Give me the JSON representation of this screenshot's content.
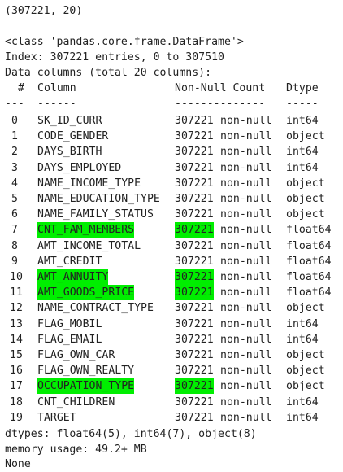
{
  "shape_output": "(307221, 20)",
  "class_line": "<class 'pandas.core.frame.DataFrame'>",
  "index_line": "Index: 307221 entries, 0 to 307510",
  "data_columns_line": "Data columns (total 20 columns):",
  "header": {
    "num": " #",
    "column": "Column",
    "count": "Non-Null Count",
    "dtype": "Dtype"
  },
  "separator": {
    "num": "---",
    "column": "------",
    "count": "--------------",
    "dtype": "-----"
  },
  "highlight_color": "#00ee00",
  "rows": [
    {
      "num": "0",
      "name": "SK_ID_CURR",
      "count": "307221",
      "nonnull": "non-null",
      "dtype": "int64",
      "highlight": false
    },
    {
      "num": "1",
      "name": "CODE_GENDER",
      "count": "307221",
      "nonnull": "non-null",
      "dtype": "object",
      "highlight": false
    },
    {
      "num": "2",
      "name": "DAYS_BIRTH",
      "count": "307221",
      "nonnull": "non-null",
      "dtype": "int64",
      "highlight": false
    },
    {
      "num": "3",
      "name": "DAYS_EMPLOYED",
      "count": "307221",
      "nonnull": "non-null",
      "dtype": "int64",
      "highlight": false
    },
    {
      "num": "4",
      "name": "NAME_INCOME_TYPE",
      "count": "307221",
      "nonnull": "non-null",
      "dtype": "object",
      "highlight": false
    },
    {
      "num": "5",
      "name": "NAME_EDUCATION_TYPE",
      "count": "307221",
      "nonnull": "non-null",
      "dtype": "object",
      "highlight": false
    },
    {
      "num": "6",
      "name": "NAME_FAMILY_STATUS",
      "count": "307221",
      "nonnull": "non-null",
      "dtype": "object",
      "highlight": false
    },
    {
      "num": "7",
      "name": "CNT_FAM_MEMBERS",
      "count": "307221",
      "nonnull": "non-null",
      "dtype": "float64",
      "highlight": true
    },
    {
      "num": "8",
      "name": "AMT_INCOME_TOTAL",
      "count": "307221",
      "nonnull": "non-null",
      "dtype": "float64",
      "highlight": false
    },
    {
      "num": "9",
      "name": "AMT_CREDIT",
      "count": "307221",
      "nonnull": "non-null",
      "dtype": "float64",
      "highlight": false
    },
    {
      "num": "10",
      "name": "AMT_ANNUITY",
      "count": "307221",
      "nonnull": "non-null",
      "dtype": "float64",
      "highlight": true
    },
    {
      "num": "11",
      "name": "AMT_GOODS_PRICE",
      "count": "307221",
      "nonnull": "non-null",
      "dtype": "float64",
      "highlight": true
    },
    {
      "num": "12",
      "name": "NAME_CONTRACT_TYPE",
      "count": "307221",
      "nonnull": "non-null",
      "dtype": "object",
      "highlight": false
    },
    {
      "num": "13",
      "name": "FLAG_MOBIL",
      "count": "307221",
      "nonnull": "non-null",
      "dtype": "int64",
      "highlight": false
    },
    {
      "num": "14",
      "name": "FLAG_EMAIL",
      "count": "307221",
      "nonnull": "non-null",
      "dtype": "int64",
      "highlight": false
    },
    {
      "num": "15",
      "name": "FLAG_OWN_CAR",
      "count": "307221",
      "nonnull": "non-null",
      "dtype": "object",
      "highlight": false
    },
    {
      "num": "16",
      "name": "FLAG_OWN_REALTY",
      "count": "307221",
      "nonnull": "non-null",
      "dtype": "object",
      "highlight": false
    },
    {
      "num": "17",
      "name": "OCCUPATION_TYPE",
      "count": "307221",
      "nonnull": "non-null",
      "dtype": "object",
      "highlight": true
    },
    {
      "num": "18",
      "name": "CNT_CHILDREN",
      "count": "307221",
      "nonnull": "non-null",
      "dtype": "int64",
      "highlight": false
    },
    {
      "num": "19",
      "name": "TARGET",
      "count": "307221",
      "nonnull": "non-null",
      "dtype": "int64",
      "highlight": false
    }
  ],
  "dtypes_line": "dtypes: float64(5), int64(7), object(8)",
  "memory_line": "memory usage: 49.2+ MB",
  "none_line": "None"
}
